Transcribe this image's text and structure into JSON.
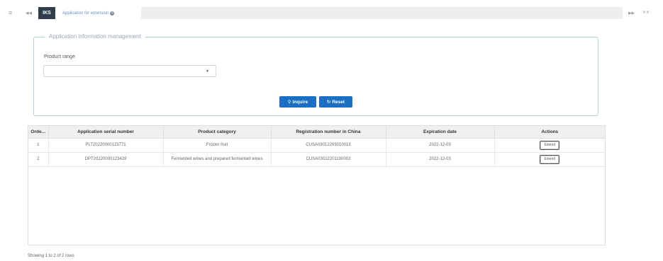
{
  "topbar": {
    "home_tab": "IKS",
    "active_tab": "Application for extension"
  },
  "panel": {
    "legend": "Application information management",
    "product_range_label": "Product range",
    "product_range_value": "",
    "inquire_label": "Inquire",
    "reset_label": "Reset"
  },
  "table": {
    "headers": [
      "Orde...",
      "Application serial number",
      "Product category",
      "Registration number in China",
      "Expiration date",
      "Actions"
    ],
    "rows": [
      {
        "order": "1",
        "serial": "PLT20220000123771",
        "category": "Frozen fruit",
        "registration": "CUSA03012203010013",
        "expiration": "2022-12-03",
        "action": "Extend"
      },
      {
        "order": "2",
        "serial": "DPT20220000123429",
        "category": "Fermented wines and prepared fermented wines",
        "registration": "CUSA03012201100002",
        "expiration": "2022-12-03",
        "action": "Extend"
      }
    ]
  },
  "footer": {
    "pagination": "Showing 1 to 2 of 2 rows"
  },
  "colors": {
    "primary_button": "#1b6fc2",
    "panel_border": "#a9d3d6",
    "home_tab_bg": "#2f3e4d"
  }
}
